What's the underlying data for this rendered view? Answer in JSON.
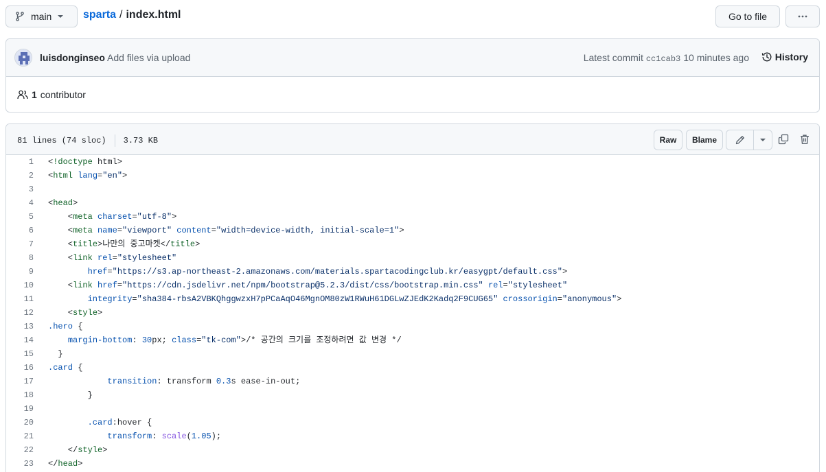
{
  "topbar": {
    "branch": "main",
    "repo": "sparta",
    "separator": "/",
    "file": "index.html",
    "goto_label": "Go to file",
    "more_label": "···"
  },
  "commit": {
    "author": "luisdonginseo",
    "message": "Add files via upload",
    "latest_label": "Latest commit",
    "sha": "cc1cab3",
    "time": "10 minutes ago",
    "history_label": "History"
  },
  "contributors": {
    "count": "1",
    "label": "contributor"
  },
  "file": {
    "lines_info": "81 lines (74 sloc)",
    "size": "3.73 KB",
    "raw_label": "Raw",
    "blame_label": "Blame"
  },
  "code_lines": [
    {
      "n": "1",
      "t": "<!doctype html>"
    },
    {
      "n": "2",
      "t": "<html lang=\"en\">"
    },
    {
      "n": "3",
      "t": ""
    },
    {
      "n": "4",
      "t": "<head>"
    },
    {
      "n": "5",
      "t": "    <meta charset=\"utf-8\">"
    },
    {
      "n": "6",
      "t": "    <meta name=\"viewport\" content=\"width=device-width, initial-scale=1\">"
    },
    {
      "n": "7",
      "t": "    <title>나만의 중고마켓</title>"
    },
    {
      "n": "8",
      "t": "    <link rel=\"stylesheet\""
    },
    {
      "n": "9",
      "t": "        href=\"https://s3.ap-northeast-2.amazonaws.com/materials.spartacodingclub.kr/easygpt/default.css\">"
    },
    {
      "n": "10",
      "t": "    <link href=\"https://cdn.jsdelivr.net/npm/bootstrap@5.2.3/dist/css/bootstrap.min.css\" rel=\"stylesheet\""
    },
    {
      "n": "11",
      "t": "        integrity=\"sha384-rbsA2VBKQhggwzxH7pPCaAqO46MgnOM80zW1RWuH61DGLwZJEdK2Kadq2F9CUG65\" crossorigin=\"anonymous\">"
    },
    {
      "n": "12",
      "t": "    <style>"
    },
    {
      "n": "13",
      "t": ".hero {"
    },
    {
      "n": "14",
      "t": "    margin-bottom: 30px; /* 공간의 크기를 조정하려면 값 변경 */"
    },
    {
      "n": "15",
      "t": "  }"
    },
    {
      "n": "16",
      "t": ".card {"
    },
    {
      "n": "17",
      "t": "            transition: transform 0.3s ease-in-out;"
    },
    {
      "n": "18",
      "t": "        }"
    },
    {
      "n": "19",
      "t": ""
    },
    {
      "n": "20",
      "t": "        .card:hover {"
    },
    {
      "n": "21",
      "t": "            transform: scale(1.05);"
    },
    {
      "n": "22",
      "t": "    </style>"
    },
    {
      "n": "23",
      "t": "</head>"
    }
  ]
}
